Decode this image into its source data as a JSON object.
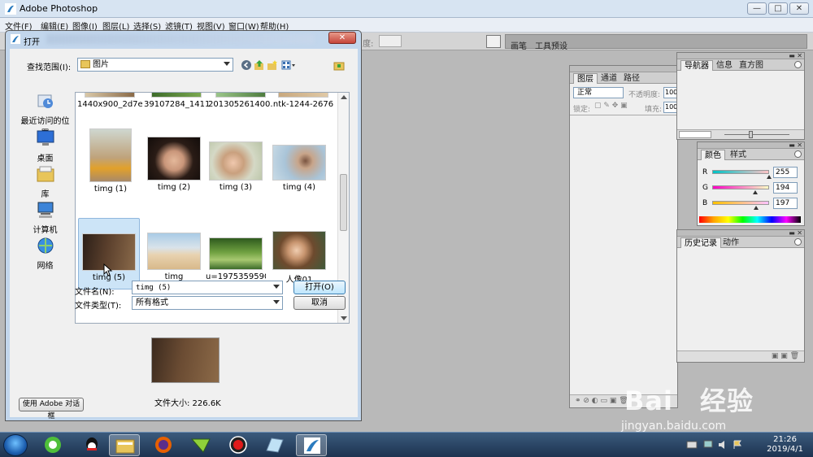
{
  "photoshop": {
    "title": "Adobe Photoshop",
    "window_buttons": [
      "—",
      "□",
      "✕"
    ],
    "menu": [
      "文件(F)",
      "编辑(E)",
      "图像(I)",
      "图层(L)",
      "选择(S)",
      "滤镜(T)",
      "视图(V)",
      "窗口(W)",
      "帮助(H)"
    ],
    "options_bar": {
      "partial_label": "度:",
      "palette_well_tabs": [
        "画笔",
        "工具预设"
      ]
    }
  },
  "panels": {
    "layers": {
      "tabs": [
        "图层",
        "通道",
        "路径"
      ],
      "blend_mode": "正常",
      "opacity_label": "不透明度:",
      "opacity_value": "100",
      "lock_label": "锁定:",
      "fill_label": "填充:",
      "fill_value": "100"
    },
    "navigator": {
      "tabs": [
        "导航器",
        "信息",
        "直方图"
      ]
    },
    "color": {
      "tabs": [
        "颜色",
        "样式"
      ],
      "channels": [
        {
          "label": "R",
          "value": "255",
          "fraction": 1.0
        },
        {
          "label": "G",
          "value": "194",
          "fraction": 0.76
        },
        {
          "label": "B",
          "value": "197",
          "fraction": 0.77
        }
      ]
    },
    "history": {
      "tabs": [
        "历史记录",
        "动作"
      ]
    }
  },
  "dialog": {
    "title": "打开",
    "close_label": "✕",
    "look_in_label": "查找范围(I):",
    "look_in_value": "图片",
    "places": [
      {
        "label": "最近访问的位置",
        "icon": "recent-places-icon"
      },
      {
        "label": "桌面",
        "icon": "desktop-icon"
      },
      {
        "label": "库",
        "icon": "libraries-icon"
      },
      {
        "label": "计算机",
        "icon": "computer-icon"
      },
      {
        "label": "网络",
        "icon": "network-icon"
      }
    ],
    "files_top_row": [
      "1440x900_2d7e...",
      "39107284_1411...",
      "201305261400...",
      "ntk-1244-2676"
    ],
    "files": [
      {
        "name": "timg (1)",
        "selected": false
      },
      {
        "name": "timg (2)",
        "selected": false
      },
      {
        "name": "timg (3)",
        "selected": false
      },
      {
        "name": "timg (4)",
        "selected": false
      },
      {
        "name": "timg (5)",
        "selected": true
      },
      {
        "name": "timg",
        "selected": false
      },
      {
        "name": "u=1975359590...",
        "selected": false
      },
      {
        "name": "人像01",
        "selected": false
      }
    ],
    "filename_label": "文件名(N):",
    "filename_value": "timg (5)",
    "filetype_label": "文件类型(T):",
    "filetype_value": "所有格式",
    "open_button": "打开(O)",
    "cancel_button": "取消",
    "file_size": "文件大小: 226.6K",
    "use_adobe_dialog_button": "使用 Adobe 对话框"
  },
  "taskbar": {
    "time": "21:26",
    "date": "2019/4/1",
    "items": [
      "360-browser-icon",
      "qq-icon",
      "file-explorer-icon",
      "firefox-icon",
      "media-player-icon",
      "screen-recorder-icon",
      "glass-app-icon",
      "photoshop-icon"
    ]
  },
  "watermark": {
    "brand": "Bai 经验",
    "url": "jingyan.baidu.com"
  }
}
